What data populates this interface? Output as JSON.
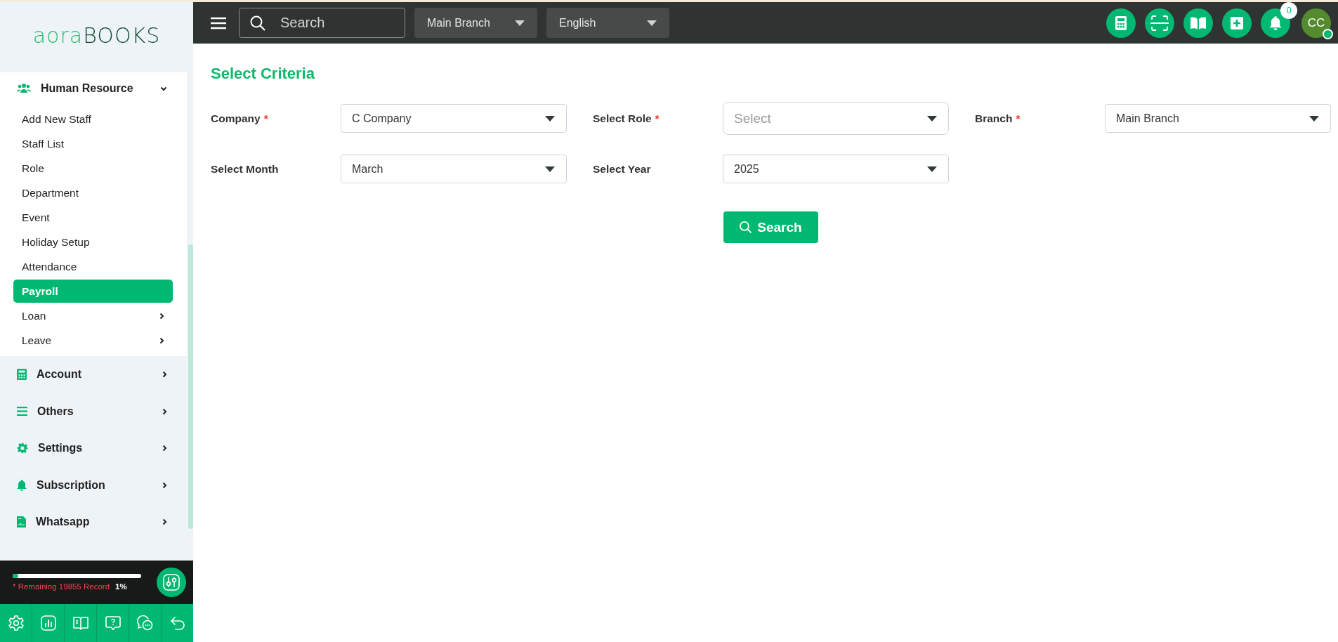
{
  "header": {
    "search_placeholder": "Search",
    "branch": "Main Branch",
    "language": "English",
    "notification_count": "0",
    "avatar": "CC",
    "online": true
  },
  "sidebar": {
    "logo": {
      "first": "aora",
      "second": "BOOKS"
    },
    "sections": [
      {
        "label": "Human Resource",
        "expanded": true,
        "children": [
          {
            "label": "Add New Staff",
            "selected": false,
            "has_submenu": false
          },
          {
            "label": "Staff List",
            "selected": false,
            "has_submenu": false
          },
          {
            "label": "Role",
            "selected": false,
            "has_submenu": false
          },
          {
            "label": "Department",
            "selected": false,
            "has_submenu": false
          },
          {
            "label": "Event",
            "selected": false,
            "has_submenu": false
          },
          {
            "label": "Holiday Setup",
            "selected": false,
            "has_submenu": false
          },
          {
            "label": "Attendance",
            "selected": false,
            "has_submenu": false
          },
          {
            "label": "Payroll",
            "selected": true,
            "has_submenu": false
          },
          {
            "label": "Loan",
            "selected": false,
            "has_submenu": true
          },
          {
            "label": "Leave",
            "selected": false,
            "has_submenu": true
          }
        ]
      },
      {
        "label": "Account",
        "expanded": false
      },
      {
        "label": "Others",
        "expanded": false
      },
      {
        "label": "Settings",
        "expanded": false
      },
      {
        "label": "Subscription",
        "expanded": false
      },
      {
        "label": "Whatsapp",
        "expanded": false
      }
    ],
    "usage": {
      "text": "* Remaining 19855 Record",
      "percent": "1%",
      "level": 0.02
    }
  },
  "form": {
    "title": "Select Criteria",
    "fields": [
      {
        "label": "Company",
        "required_mark": "*",
        "value": "C Company"
      },
      {
        "label": "Select Role",
        "required_mark": "*",
        "placeholder": "Select"
      },
      {
        "label": "Branch",
        "required_mark": "*",
        "value": "Main Branch"
      },
      {
        "label": "Select Month",
        "value": "March"
      },
      {
        "label": "Select Year",
        "value": "2025"
      }
    ],
    "search_button": "Search"
  }
}
